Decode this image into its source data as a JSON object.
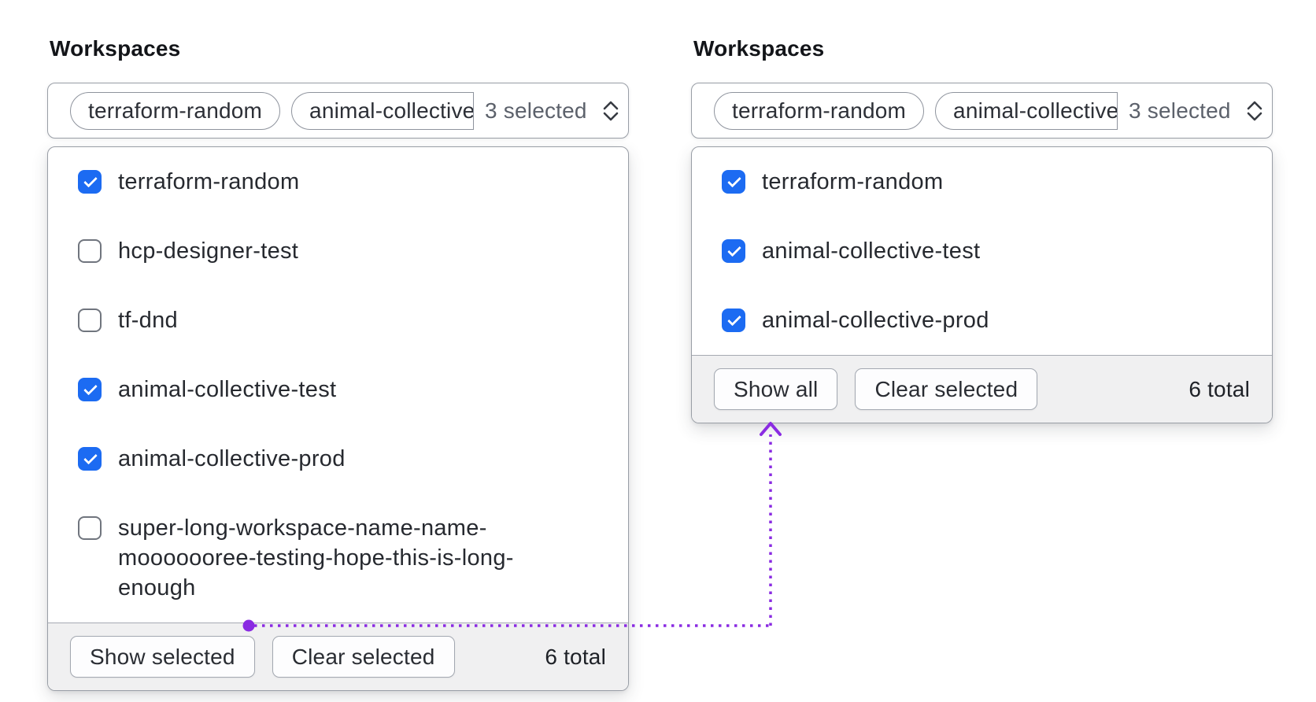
{
  "colors": {
    "checkbox_blue": "#1c6bf2",
    "annotation_purple": "#8a2be2"
  },
  "panels": [
    {
      "label": "Workspaces",
      "trigger": {
        "tags": [
          {
            "label": "terraform-random",
            "clipped": false
          },
          {
            "label": "animal-collective",
            "clipped": true
          }
        ],
        "summary": "3 selected",
        "icon": "caret-sort-icon"
      },
      "options": [
        {
          "label": "terraform-random",
          "checked": true
        },
        {
          "label": "hcp-designer-test",
          "checked": false
        },
        {
          "label": "tf-dnd",
          "checked": false
        },
        {
          "label": "animal-collective-test",
          "checked": true
        },
        {
          "label": "animal-collective-prod",
          "checked": true
        },
        {
          "label": "super-long-workspace-name-name-mooooooree-testing-hope-this-is-long-enough",
          "checked": false
        }
      ],
      "footer": {
        "primary_action": "Show selected",
        "secondary_action": "Clear selected",
        "total": "6 total"
      }
    },
    {
      "label": "Workspaces",
      "trigger": {
        "tags": [
          {
            "label": "terraform-random",
            "clipped": false
          },
          {
            "label": "animal-collective",
            "clipped": true
          }
        ],
        "summary": "3 selected",
        "icon": "caret-sort-icon"
      },
      "options": [
        {
          "label": "terraform-random",
          "checked": true
        },
        {
          "label": "animal-collective-test",
          "checked": true
        },
        {
          "label": "animal-collective-prod",
          "checked": true
        }
      ],
      "footer": {
        "primary_action": "Show all",
        "secondary_action": "Clear selected",
        "total": "6 total"
      }
    }
  ]
}
